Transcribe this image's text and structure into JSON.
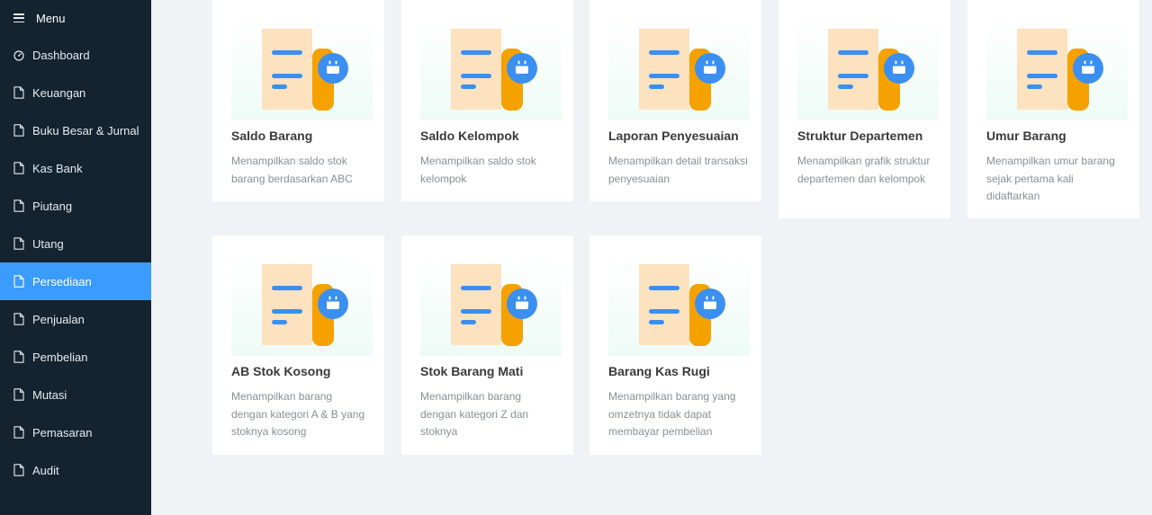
{
  "sidebar": {
    "menu_label": "Menu",
    "items": [
      {
        "label": "Dashboard",
        "icon": "dashboard-icon",
        "active": false
      },
      {
        "label": "Keuangan",
        "icon": "file-icon",
        "active": false
      },
      {
        "label": "Buku Besar & Jurnal",
        "icon": "file-icon",
        "active": false
      },
      {
        "label": "Kas Bank",
        "icon": "file-icon",
        "active": false
      },
      {
        "label": "Piutang",
        "icon": "file-icon",
        "active": false
      },
      {
        "label": "Utang",
        "icon": "file-icon",
        "active": false
      },
      {
        "label": "Persediaan",
        "icon": "file-icon",
        "active": true
      },
      {
        "label": "Penjualan",
        "icon": "file-icon",
        "active": false
      },
      {
        "label": "Pembelian",
        "icon": "file-icon",
        "active": false
      },
      {
        "label": "Mutasi",
        "icon": "file-icon",
        "active": false
      },
      {
        "label": "Pemasaran",
        "icon": "file-icon",
        "active": false
      },
      {
        "label": "Audit",
        "icon": "file-icon",
        "active": false
      }
    ]
  },
  "cards": [
    {
      "title": "Saldo Barang",
      "desc": "Menampilkan saldo stok barang berdasarkan ABC"
    },
    {
      "title": "Saldo Kelompok",
      "desc": "Menampilkan saldo stok kelompok"
    },
    {
      "title": "Laporan Penyesuaian",
      "desc": "Menampilkan detail transaksi penyesuaian"
    },
    {
      "title": "Struktur Departemen",
      "desc": "Menampilkan grafik struktur departemen dan kelompok"
    },
    {
      "title": "Umur Barang",
      "desc": "Menampilkan umur barang sejak pertama kali didaftarkan"
    },
    {
      "title": "AB Stok Kosong",
      "desc": "Menampilkan barang dengan kategori A & B yang stoknya kosong"
    },
    {
      "title": "Stok Barang Mati",
      "desc": "Menampilkan barang dengan kategori Z dan stoknya"
    },
    {
      "title": "Barang Kas Rugi",
      "desc": "Menampilkan barang yang omzetnya tidak dapat membayar pembelian"
    }
  ],
  "colors": {
    "sidebar_bg": "#13232f",
    "active_bg": "#3b9bff",
    "doc_paper": "#fde2bf",
    "doc_fold": "#f5a100",
    "doc_lines": "#3b8ff0",
    "badge": "#3b8ff0"
  }
}
